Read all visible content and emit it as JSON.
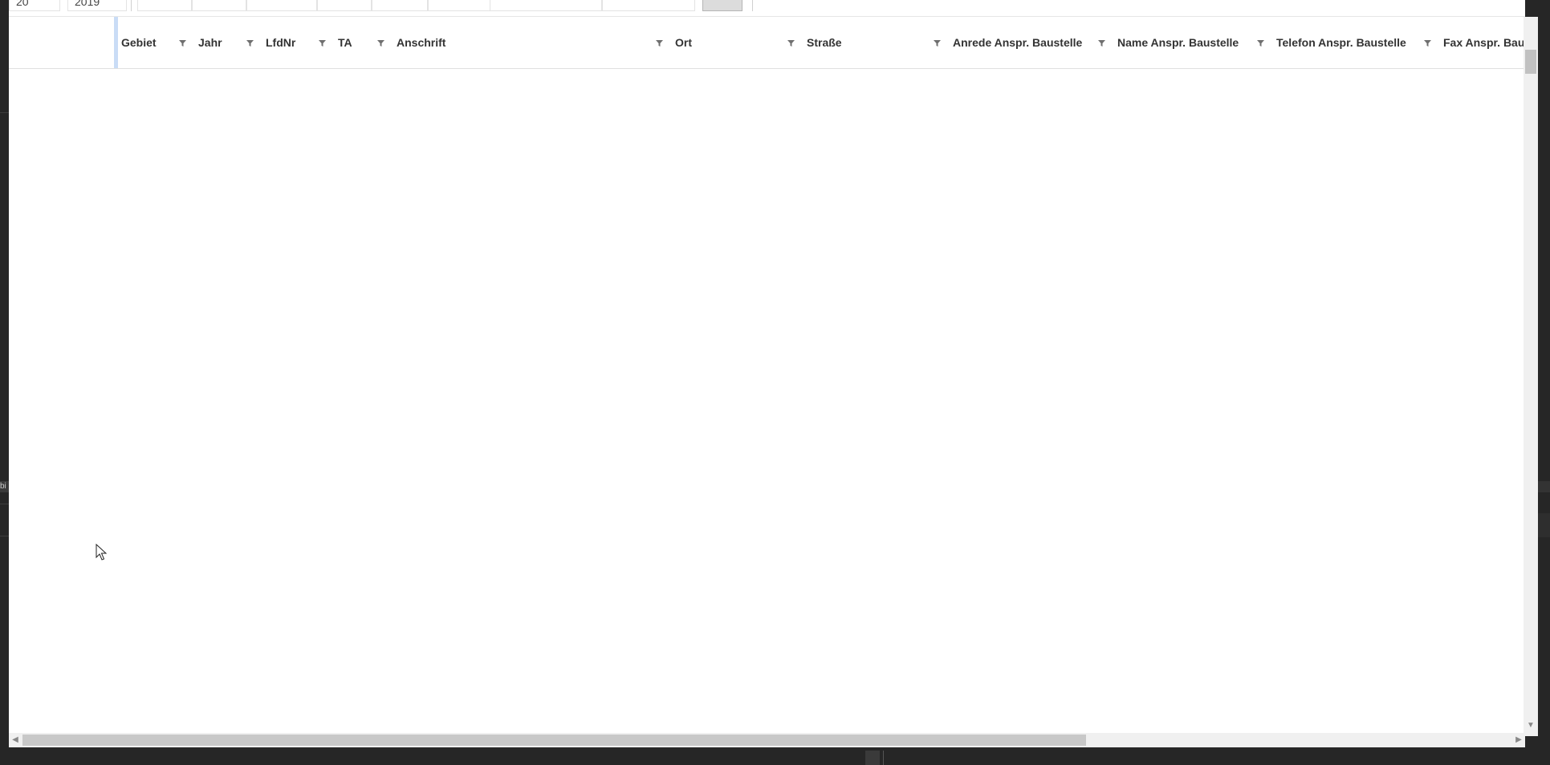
{
  "toolbar": {
    "items": [
      "20",
      "2019",
      "",
      "",
      "",
      "",
      "",
      "",
      "",
      ""
    ]
  },
  "grid": {
    "columns": [
      {
        "key": "gebiet",
        "label": "Gebiet"
      },
      {
        "key": "jahr",
        "label": "Jahr"
      },
      {
        "key": "lfdnr",
        "label": "LfdNr"
      },
      {
        "key": "ta",
        "label": "TA"
      },
      {
        "key": "anschrift",
        "label": "Anschrift"
      },
      {
        "key": "ort",
        "label": "Ort"
      },
      {
        "key": "strasse",
        "label": "Straße"
      },
      {
        "key": "anrede",
        "label": "Anrede Anspr. Baustelle"
      },
      {
        "key": "name",
        "label": "Name Anspr. Baustelle"
      },
      {
        "key": "telefon",
        "label": "Telefon Anspr. Baustelle"
      },
      {
        "key": "fax",
        "label": "Fax Anspr. Baus"
      }
    ],
    "rows": []
  },
  "side": {
    "left_label": "bi"
  },
  "colors": {
    "background": "#262626",
    "header_accent": "#c9dcf6",
    "filter_icon": "#6f6f6f"
  }
}
